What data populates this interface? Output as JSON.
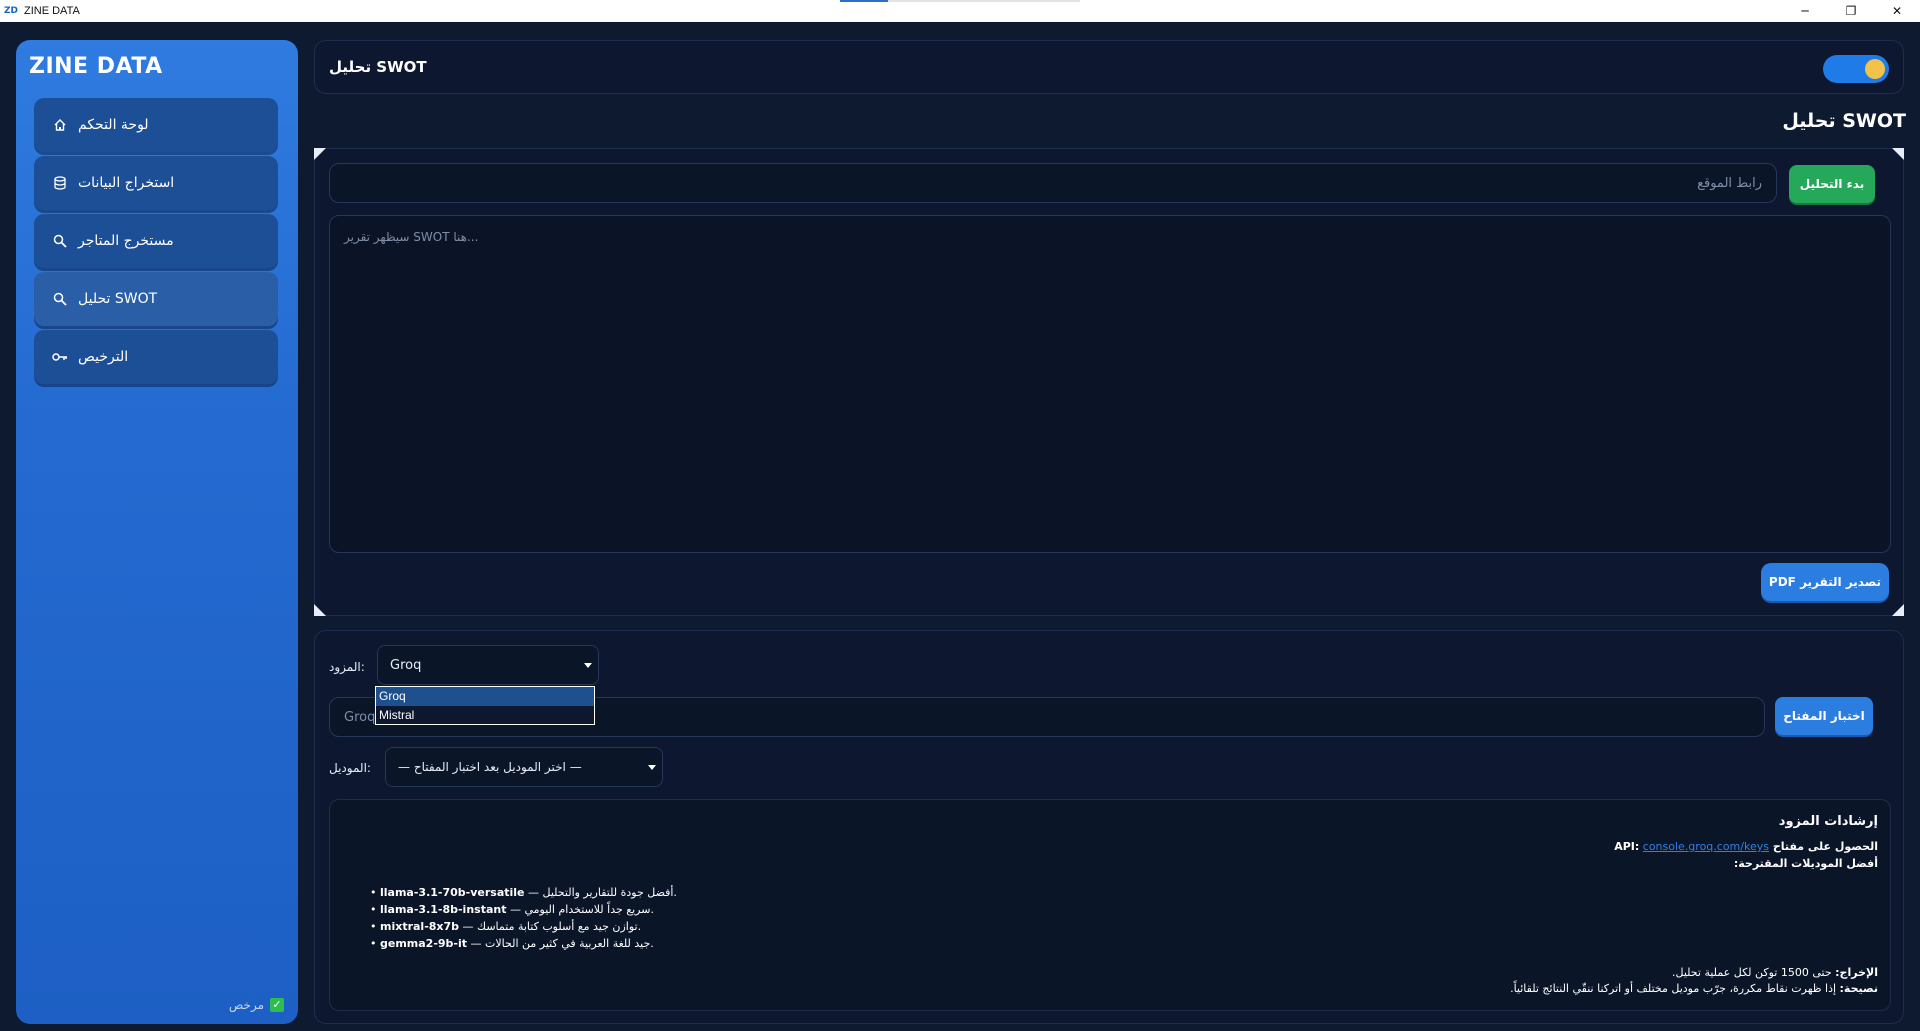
{
  "window": {
    "logo": "ZD",
    "title": "ZINE DATA",
    "progress": 0.2,
    "controls": {
      "minimize": "─",
      "restore": "❐",
      "close": "✕"
    }
  },
  "sidebar": {
    "brand": "ZINE DATA",
    "items": [
      {
        "label": "لوحة التحكم",
        "icon": "home-icon"
      },
      {
        "label": "استخراج البيانات",
        "icon": "database-icon"
      },
      {
        "label": "مستخرج المتاجر",
        "icon": "search-icon"
      },
      {
        "label": "تحليل SWOT",
        "icon": "search-icon",
        "active": true
      },
      {
        "label": "الترخيص",
        "icon": "key-icon"
      }
    ],
    "license_label": "مرخص",
    "license_check": "✓"
  },
  "header": {
    "title": "تحليل SWOT",
    "toggle_on": true
  },
  "page": {
    "heading": "تحليل SWOT"
  },
  "analysis": {
    "url_placeholder": "رابط الموقع",
    "start_button": "بدء التحليل",
    "report_placeholder": "سيظهر تقرير SWOT هنا...",
    "export_button": "PDF تصدير التقرير"
  },
  "provider": {
    "label": "المزود:",
    "selected": "Groq",
    "options": [
      "Groq",
      "Mistral"
    ],
    "key_placeholder": "Groq API Key",
    "key_button": "اختبار المفتاح",
    "model_label": "الموديل:",
    "model_selected": "— اختر الموديل بعد اختبار المفتاح —"
  },
  "guide": {
    "title": "إرشادات المزود",
    "api_label": "الحصول على مفتاح API:",
    "api_link": "console.groq.com/keys",
    "models_heading": "أفضل الموديلات المقترحة:",
    "models": [
      {
        "name": "llama-3.1-70b-versatile",
        "desc": " — أفضل جودة للتقارير والتحليل."
      },
      {
        "name": "llama-3.1-8b-instant",
        "desc": " — سريع جداً للاستخدام اليومي."
      },
      {
        "name": "mixtral-8x7b",
        "desc": " — توازن جيد مع أسلوب كتابة متماسك."
      },
      {
        "name": "gemma2-9b-it",
        "desc": " — جيد للغة العربية في كثير من الحالات."
      }
    ],
    "output_label": "الإخراج:",
    "output_text": "حتى 1500 توكن لكل عملية تحليل.",
    "tip_label": "نصيحة:",
    "tip_text": "إذا ظهرت نقاط مكررة، جرّب موديل مختلف أو اتركنا ننقّي النتائج تلقائياً."
  }
}
